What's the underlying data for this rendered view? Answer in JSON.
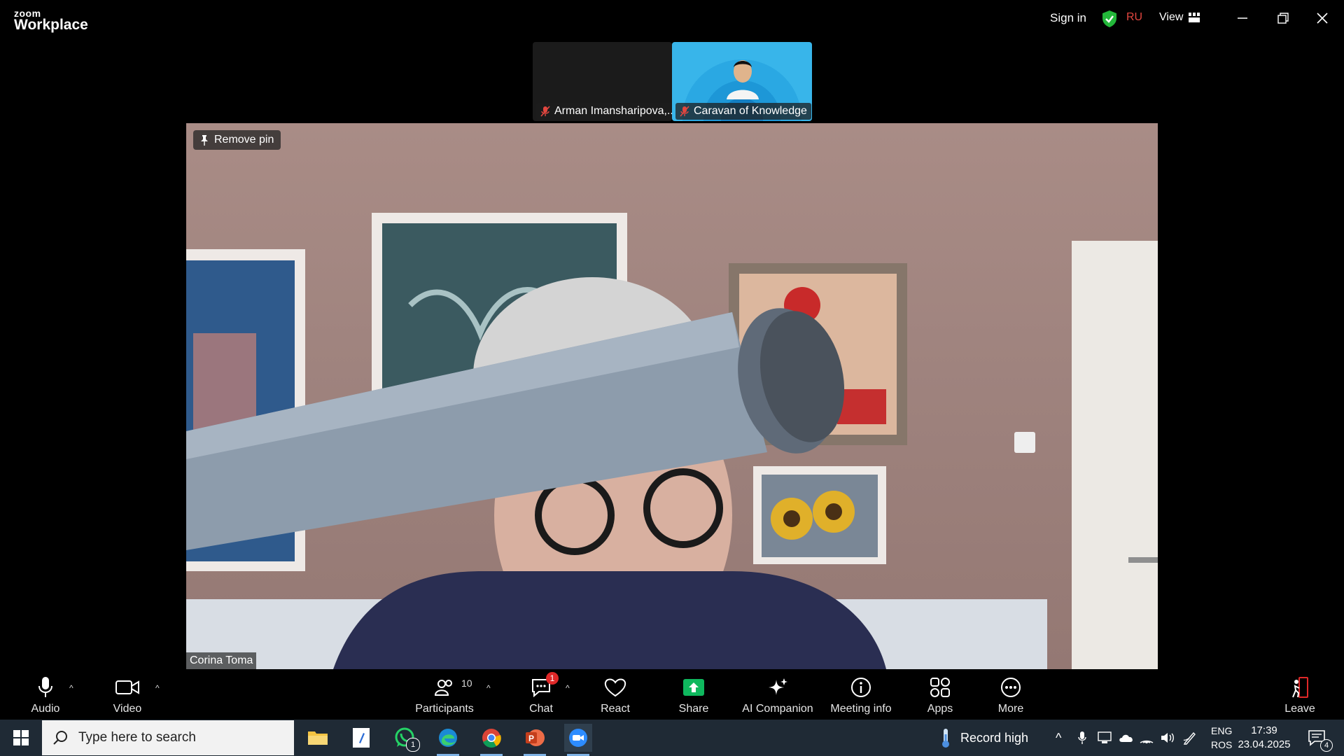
{
  "titlebar": {
    "logo_small": "zoom",
    "logo_big": "Workplace",
    "sign_in": "Sign in",
    "region": "RU",
    "view": "View"
  },
  "thumbnails": [
    {
      "name": "Arman Imansharipova,..."
    },
    {
      "name": "Caravan of Knowledge"
    }
  ],
  "main_video": {
    "pin_label": "Remove pin",
    "participant_name": "Corina Toma"
  },
  "toolbar": {
    "audio": "Audio",
    "video": "Video",
    "participants": "Participants",
    "participants_count": "10",
    "chat": "Chat",
    "chat_badge": "1",
    "react": "React",
    "share": "Share",
    "ai_companion": "AI Companion",
    "meeting_info": "Meeting info",
    "apps": "Apps",
    "more": "More",
    "leave": "Leave"
  },
  "taskbar": {
    "search_placeholder": "Type here to search",
    "whatsapp_badge": "1",
    "weather": "Record high",
    "lang_top": "ENG",
    "lang_bottom": "ROS",
    "time": "17:39",
    "date": "23.04.2025",
    "notifications": "4"
  },
  "colors": {
    "accent_green": "#23b83a",
    "share_green": "#0fb85e",
    "region_red": "#e2463f",
    "badge_red": "#e02828"
  }
}
